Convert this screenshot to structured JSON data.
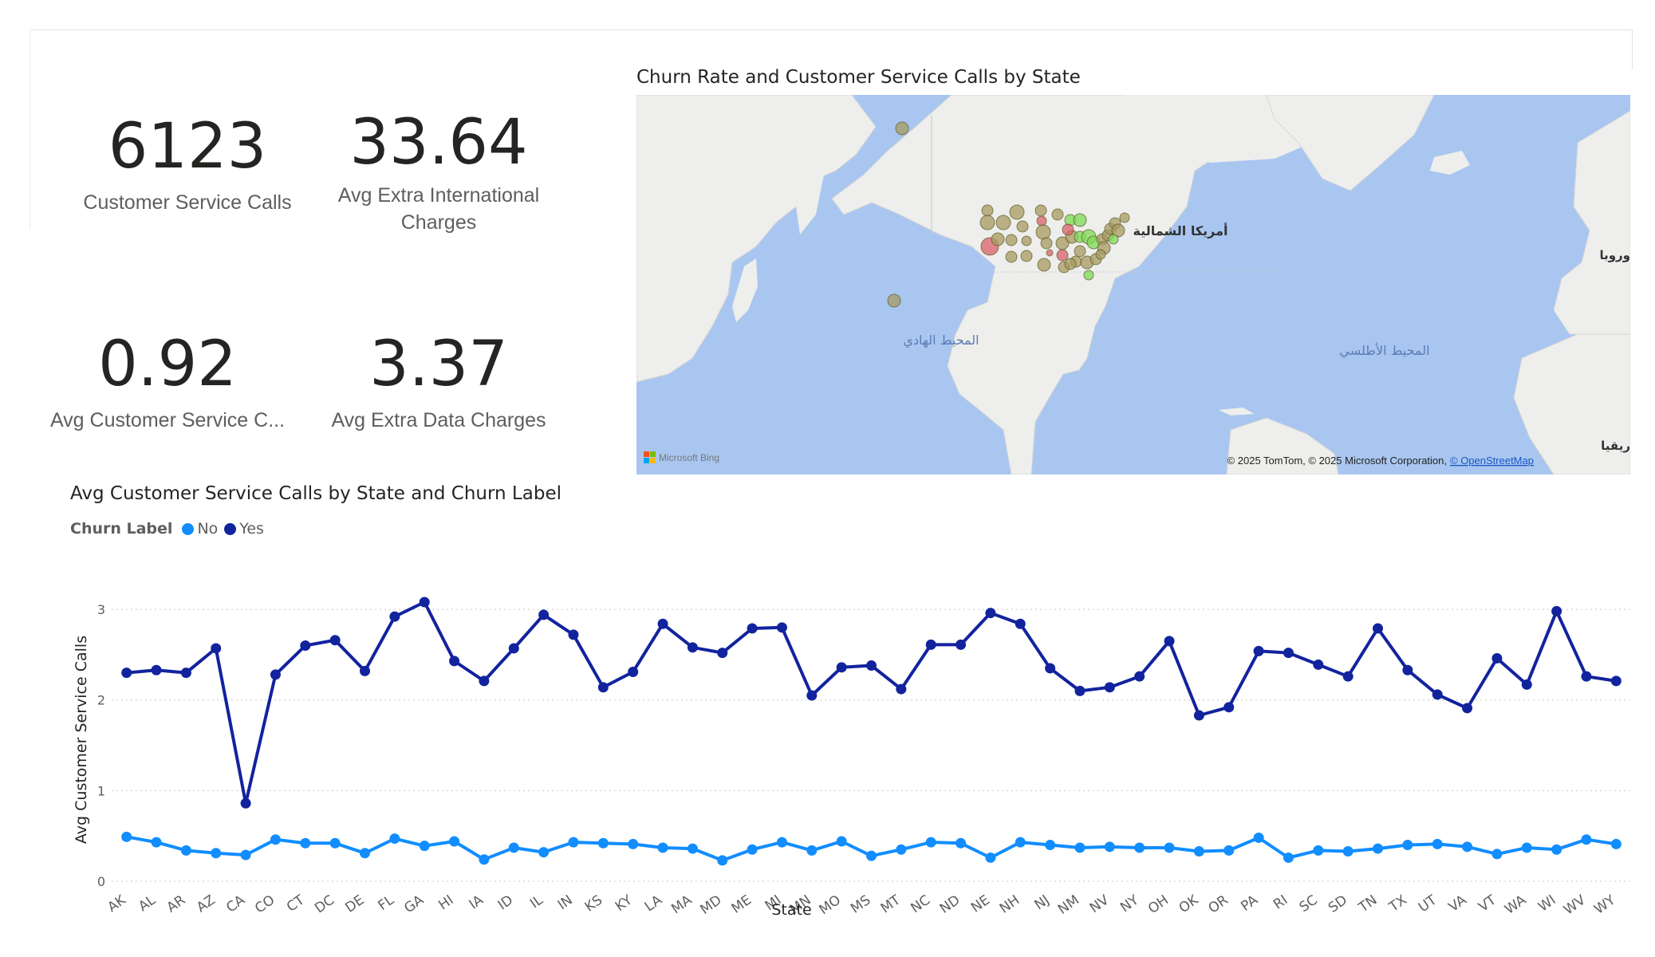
{
  "cards": [
    {
      "value": "6123",
      "label": "Customer Service Calls"
    },
    {
      "value": "33.64",
      "label": "Avg Extra International Charges"
    },
    {
      "value": "0.92",
      "label": "Avg Customer Service C..."
    },
    {
      "value": "3.37",
      "label": "Avg Extra Data Charges"
    }
  ],
  "map": {
    "title": "Churn Rate and Customer Service Calls by State",
    "labels": {
      "north_america": "أمريكا الشمالية",
      "pacific": "المحيط الهادي",
      "atlantic": "المحيط الأطلسي",
      "europe": "وروبا",
      "africa": "ريقيا"
    },
    "bing_logo": "Microsoft Bing",
    "attribution": "© 2025 TomTom, © 2025 Microsoft Corporation,",
    "attribution_link": "© OpenStreetMap",
    "colors": {
      "water": "#a9c6f0",
      "land": "#eeeeec",
      "low_churn": "#7ed957",
      "mid": "#a79a5f",
      "high_churn": "#d9606b"
    }
  },
  "chart_data": {
    "type": "line",
    "title": "Avg Customer Service Calls by State and Churn Label",
    "legend_title": "Churn Label",
    "xlabel": "State",
    "ylabel": "Avg Customer Service Calls",
    "ylim": [
      0,
      3.3
    ],
    "yticks": [
      0,
      1,
      2,
      3
    ],
    "grid": true,
    "legend_position": "top-left",
    "categories": [
      "AK",
      "AL",
      "AR",
      "AZ",
      "CA",
      "CO",
      "CT",
      "DC",
      "DE",
      "FL",
      "GA",
      "HI",
      "IA",
      "ID",
      "IL",
      "IN",
      "KS",
      "KY",
      "LA",
      "MA",
      "MD",
      "ME",
      "MI",
      "MN",
      "MO",
      "MS",
      "MT",
      "NC",
      "ND",
      "NE",
      "NH",
      "NJ",
      "NM",
      "NV",
      "NY",
      "OH",
      "OK",
      "OR",
      "PA",
      "RI",
      "SC",
      "SD",
      "TN",
      "TX",
      "UT",
      "VA",
      "VT",
      "WA",
      "WI",
      "WV",
      "WY"
    ],
    "series": [
      {
        "name": "No",
        "color": "#118dff",
        "values": [
          0.49,
          0.43,
          0.34,
          0.31,
          0.29,
          0.46,
          0.42,
          0.42,
          0.31,
          0.47,
          0.39,
          0.44,
          0.24,
          0.37,
          0.32,
          0.43,
          0.42,
          0.41,
          0.37,
          0.36,
          0.23,
          0.35,
          0.43,
          0.34,
          0.44,
          0.28,
          0.35,
          0.43,
          0.42,
          0.26,
          0.43,
          0.4,
          0.37,
          0.38,
          0.37,
          0.37,
          0.33,
          0.34,
          0.48,
          0.26,
          0.34,
          0.33,
          0.36,
          0.4,
          0.41,
          0.38,
          0.3,
          0.37,
          0.35,
          0.46,
          0.41
        ]
      },
      {
        "name": "Yes",
        "color": "#12239e",
        "values": [
          2.3,
          2.33,
          2.3,
          2.57,
          0.86,
          2.28,
          2.6,
          2.66,
          2.32,
          2.92,
          3.08,
          2.43,
          2.21,
          2.57,
          2.94,
          2.72,
          2.14,
          2.31,
          2.84,
          2.58,
          2.52,
          2.79,
          2.8,
          2.05,
          2.36,
          2.38,
          2.12,
          2.61,
          2.61,
          2.96,
          2.84,
          2.35,
          2.1,
          2.14,
          2.26,
          2.65,
          1.83,
          1.92,
          2.54,
          2.52,
          2.39,
          2.26,
          2.79,
          2.33,
          2.06,
          1.91,
          2.46,
          2.17,
          2.98,
          2.26,
          2.21
        ]
      }
    ]
  }
}
